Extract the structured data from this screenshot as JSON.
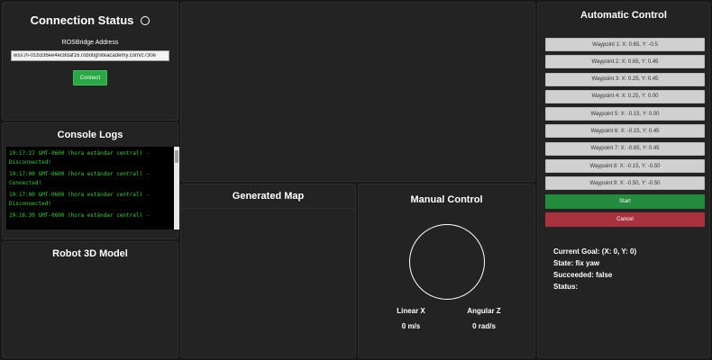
{
  "connection": {
    "title": "Connection Status",
    "address_label": "ROSBridge Address",
    "address_value": "wss://i-01b336ee4ec8daf16.robotigniteacademy.com/c730e",
    "connect_label": "Connect"
  },
  "console": {
    "title": "Console Logs",
    "logs": [
      "19:17:27 GMT-0600 (hora estándar central) - Disconnected!",
      "19:17:00 GMT-0600 (hora estándar central) - Connected!",
      "19:17:00 GMT-0600 (hora estándar central) - Disconnected!",
      "19:16:30 GMT-0600 (hora estándar central) -"
    ]
  },
  "robot3d": {
    "title": "Robot 3D Model"
  },
  "map": {
    "title": "Generated Map"
  },
  "manual": {
    "title": "Manual Control",
    "linear_label": "Linear X",
    "linear_value": "0 m/s",
    "angular_label": "Angular Z",
    "angular_value": "0 rad/s"
  },
  "auto": {
    "title": "Automatic Control",
    "waypoints": [
      "Waypoint 1:     X: 0.65,  Y: -0.5",
      "Waypoint 2:     X: 0.65,  Y: 0.45",
      "Waypoint 3:     X: 0.25,  Y: 0.45",
      "Waypoint 4:     X: 0.25,  Y: 0.00",
      "Waypoint 5:     X: -0.15,  Y: 0.00",
      "Waypoint 6:     X: -0.15,  Y: 0.45",
      "Waypoint 7:     X: -0.65,  Y: 0.45",
      "Waypoint 8:     X: -0.15,  Y: -0.50",
      "Waypoint 9:     X: -0.50,  Y: -0.50"
    ],
    "start_label": "Start",
    "cancel_label": "Cancel",
    "current_goal": "Current Goal: (X: 0, Y: 0)",
    "state": "State: fix yaw",
    "succeeded": "Succeeded: false",
    "status": "Status:"
  },
  "colors": {
    "background": "#181818",
    "panel": "#232323",
    "connect_green": "#29a845",
    "start_green": "#248a3d",
    "cancel_red": "#a8323e",
    "log_green": "#2fd12f",
    "waypoint_gray": "#d0d0d0"
  }
}
